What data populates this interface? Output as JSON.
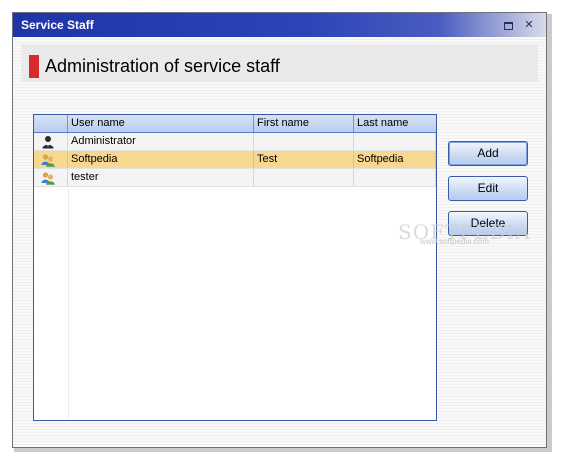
{
  "window": {
    "title": "Service Staff",
    "restore_button": "restore",
    "close_button": "✕"
  },
  "header": {
    "title": "Administration of service staff",
    "accent_color": "#d82a2a"
  },
  "grid": {
    "columns": [
      "",
      "User name",
      "First name",
      "Last name"
    ],
    "rows": [
      {
        "icon": "admin-user-icon",
        "user_name": "Administrator",
        "first_name": "",
        "last_name": "",
        "selected": false
      },
      {
        "icon": "user-icon",
        "user_name": "Softpedia",
        "first_name": "Test",
        "last_name": "Softpedia",
        "selected": true
      },
      {
        "icon": "user-icon",
        "user_name": "tester",
        "first_name": "",
        "last_name": "",
        "selected": false
      }
    ]
  },
  "actions": {
    "add": "Add",
    "edit": "Edit",
    "delete": "Delete"
  },
  "watermark": {
    "text": "SOFTPEDIA",
    "sub": "www.softpedia.com"
  },
  "colors": {
    "titlebar": "#2c44b8",
    "selection": "#f6d891",
    "grid_border": "#3a57a8"
  }
}
